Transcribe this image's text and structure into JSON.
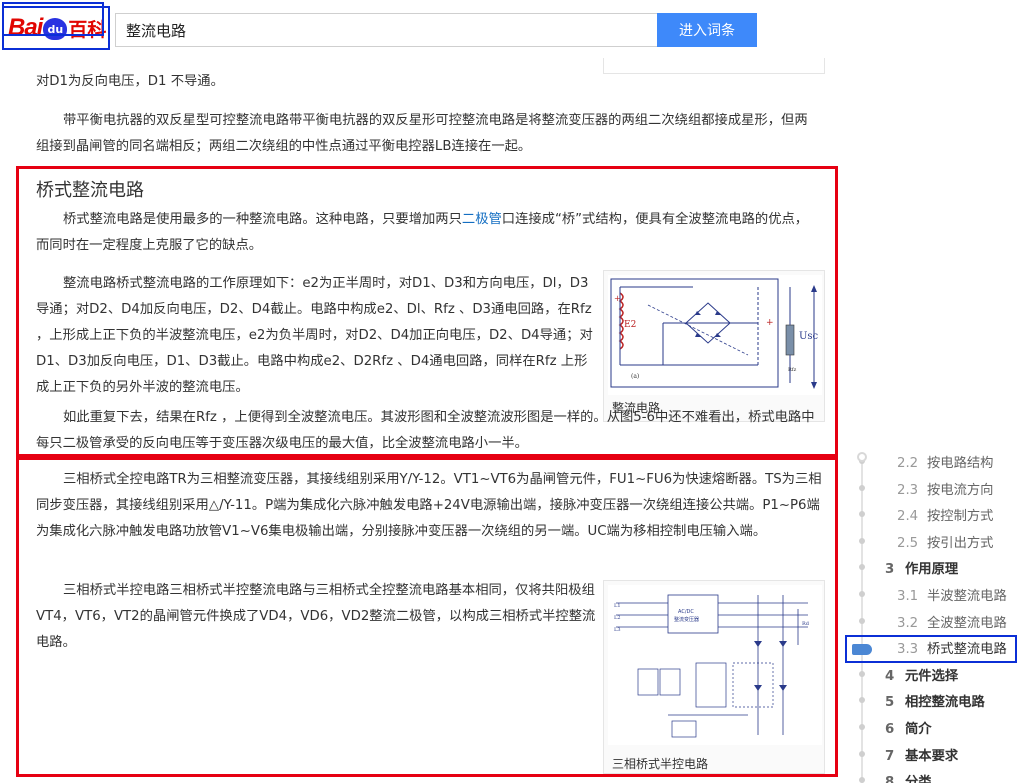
{
  "header": {
    "logo_text_bai": "Bai",
    "logo_text_du": "du",
    "logo_text_baike": "百科",
    "search_value": "整流电路",
    "search_button": "进入词条"
  },
  "article": {
    "top_partial": "对D1为反向电压，D1 不导通。",
    "para_double_star": "带平衡电抗器的双反星型可控整流电路带平衡电抗器的双反星形可控整流电路是将整流变压器的两组二次绕组都接成星形，但两组接到晶闸管的同名端相反；两组二次绕组的中性点通过平衡电控器LB连接在一起。",
    "bridge_title": "桥式整流电路",
    "bridge_p1_a": "桥式整流电路是使用最多的一种整流电路。这种电路，只要增加两只",
    "bridge_p1_link": "二极管",
    "bridge_p1_b": "口连接成“桥”式结构，便具有全波整流电路的优点，而同时在一定程度上克服了它的缺点。",
    "bridge_p2": "整流电路桥式整流电路的工作原理如下：e2为正半周时，对D1、D3和方向电压，Dl，D3导通；对D2、D4加反向电压，D2、D4截止。电路中构成e2、Dl、Rfz 、D3通电回路，在Rfz ，上形成上正下负的半波整流电压，e2为负半周时，对D2、D4加正向电压，D2、D4导通；对D1、D3加反向电压，D1、D3截止。电路中构成e2、D2Rfz 、D4通电回路，同样在Rfz 上形成上正下负的另外半波的整流电压。",
    "bridge_p3": "如此重复下去，结果在Rfz ，上便得到全波整流电压。其波形图和全波整流波形图是一样的。从图5-6中还不难看出，桥式电路中每只二极管承受的反向电压等于变压器次级电压的最大值，比全波整流电路小一半。",
    "bridge_fig_caption": "整流电路",
    "three_phase_p1": "三相桥式全控电路TR为三相整流变压器，其接线组别采用Y/Y-12。VT1~VT6为晶闸管元件，FU1~FU6为快速熔断器。TS为三相同步变压器，其接线组别采用△/Y-11。P端为集成化六脉冲触发电路+24V电源输出端，接脉冲变压器一次绕组连接公共端。P1~P6端为集成化六脉冲触发电路功放管V1~V6集电极输出端，分别接脉冲变压器一次绕组的另一端。UC端为移相控制电压输入端。",
    "three_phase_p2": "三相桥式半控电路三相桥式半控整流电路与三相桥式全控整流电路基本相同，仅将共阳极组VT4，VT6，VT2的晶闸管元件换成了VD4，VD6，VD2整流二极管，以构成三相桥式半控整流电路。",
    "half_fig_caption": "三相桥式半控电路"
  },
  "toc": {
    "items": [
      {
        "num": "2.2",
        "label": "按电路结构",
        "level": "sub"
      },
      {
        "num": "2.3",
        "label": "按电流方向",
        "level": "sub"
      },
      {
        "num": "2.4",
        "label": "按控制方式",
        "level": "sub"
      },
      {
        "num": "2.5",
        "label": "按引出方式",
        "level": "sub"
      },
      {
        "num": "3",
        "label": "作用原理",
        "level": "main"
      },
      {
        "num": "3.1",
        "label": "半波整流电路",
        "level": "sub"
      },
      {
        "num": "3.2",
        "label": "全波整流电路",
        "level": "sub"
      },
      {
        "num": "3.3",
        "label": "桥式整流电路",
        "level": "sub",
        "active": true
      },
      {
        "num": "4",
        "label": "元件选择",
        "level": "main"
      },
      {
        "num": "5",
        "label": "相控整流电路",
        "level": "main"
      },
      {
        "num": "6",
        "label": "简介",
        "level": "main"
      },
      {
        "num": "7",
        "label": "基本要求",
        "level": "main"
      },
      {
        "num": "8",
        "label": "分类",
        "level": "main"
      }
    ]
  },
  "colors": {
    "highlight_red": "#e60012",
    "highlight_blue": "#0b2fd6",
    "button_blue": "#3e89fa",
    "link_blue": "#136ec2"
  }
}
